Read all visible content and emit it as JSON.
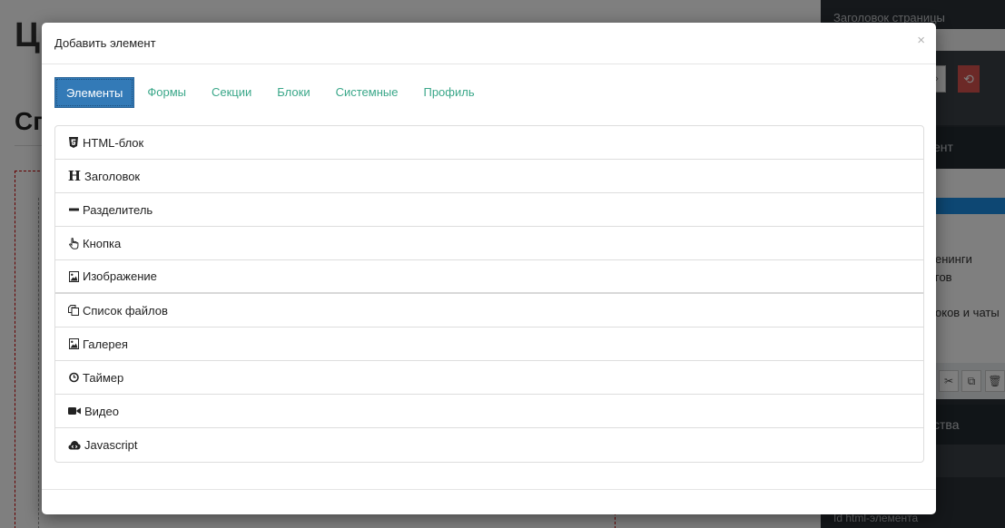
{
  "background": {
    "heading_big": "Ц",
    "heading_mid": "Сп",
    "side_title": "Заголовок страницы",
    "side_section1": "ент",
    "side_items": [
      "енинги",
      "гов",
      "оков и чаты"
    ],
    "side_section2": "ства",
    "side_field_label": "Id html-элемента"
  },
  "modal": {
    "title": "Добавить элемент",
    "close_symbol": "×",
    "tabs": [
      {
        "label": "Элементы",
        "active": true
      },
      {
        "label": "Формы",
        "active": false
      },
      {
        "label": "Секции",
        "active": false
      },
      {
        "label": "Блоки",
        "active": false
      },
      {
        "label": "Системные",
        "active": false
      },
      {
        "label": "Профиль",
        "active": false
      }
    ],
    "items": [
      {
        "label": "HTML-блок",
        "icon": "html5-icon"
      },
      {
        "label": "Заголовок",
        "icon": "heading-icon"
      },
      {
        "label": "Разделитель",
        "icon": "minus-icon"
      },
      {
        "label": "Кнопка",
        "icon": "hand-pointer-icon"
      },
      {
        "label": "Изображение",
        "icon": "image-icon"
      },
      {
        "label": "Список файлов",
        "icon": "copy-files-icon"
      },
      {
        "label": "Галерея",
        "icon": "image-icon"
      },
      {
        "label": "Таймер",
        "icon": "clock-icon"
      },
      {
        "label": "Видео",
        "icon": "video-camera-icon"
      },
      {
        "label": "Javascript",
        "icon": "cloud-code-icon"
      }
    ]
  },
  "colors": {
    "tab_active_bg": "#337ab7",
    "tab_link": "#3aa789",
    "backdrop": "rgba(0,0,0,0.5)",
    "sidebar_dark": "#2b3137"
  }
}
